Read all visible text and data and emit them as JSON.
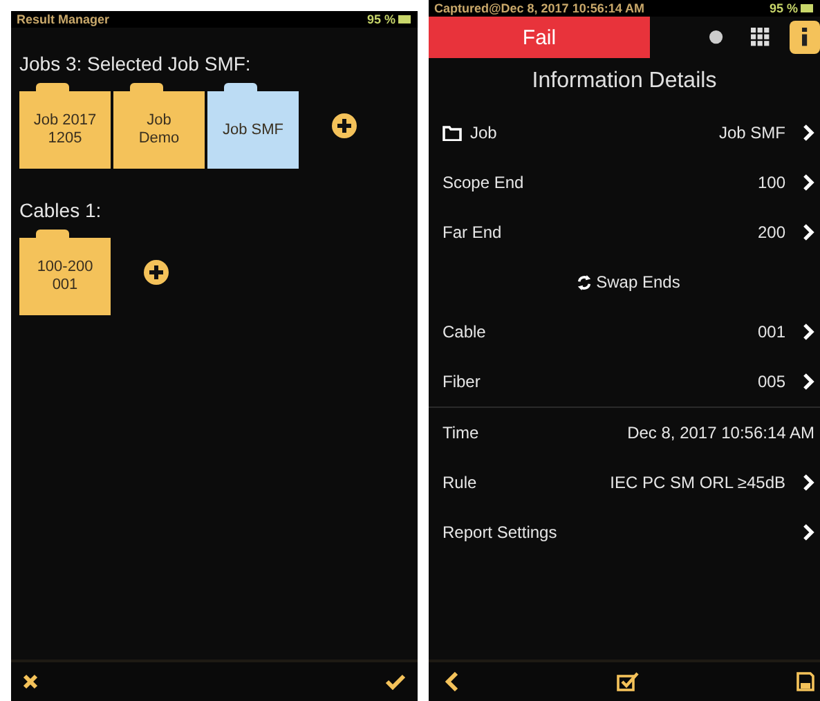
{
  "result_manager": {
    "status_bar": {
      "title": "Result Manager",
      "battery": "95 %"
    },
    "jobs_heading": "Jobs 3: Selected Job SMF:",
    "jobs": [
      {
        "label": "Job 2017\n1205",
        "selected": false
      },
      {
        "label": "Job\nDemo",
        "selected": false
      },
      {
        "label": "Job SMF",
        "selected": true
      }
    ],
    "cables_heading": "Cables 1:",
    "cables": [
      {
        "label": "100-200\n001",
        "selected": false
      }
    ]
  },
  "details": {
    "status_bar": {
      "title": "Captured@Dec 8, 2017 10:56:14 AM",
      "battery": "95 %"
    },
    "result": {
      "label": "Fail",
      "kind": "fail"
    },
    "view_tabs": [
      {
        "kind": "dot",
        "selected": false
      },
      {
        "kind": "grid",
        "selected": false
      },
      {
        "kind": "info",
        "selected": true
      }
    ],
    "heading": "Information Details",
    "rows": [
      {
        "kind": "folder",
        "label": "Job",
        "value": "Job SMF"
      },
      {
        "kind": "nav",
        "label": "Scope End",
        "value": "100"
      },
      {
        "kind": "nav",
        "label": "Far End",
        "value": "200"
      },
      {
        "kind": "action",
        "label": "Swap Ends"
      },
      {
        "kind": "nav",
        "label": "Cable",
        "value": "001"
      },
      {
        "kind": "nav",
        "label": "Fiber",
        "value": "005"
      },
      {
        "kind": "info",
        "label": "Time",
        "value": "Dec 8, 2017 10:56:14 AM"
      },
      {
        "kind": "nav",
        "label": "Rule",
        "value": "IEC PC SM ORL ≥45dB"
      },
      {
        "kind": "nav",
        "label": "Report Settings"
      }
    ]
  }
}
